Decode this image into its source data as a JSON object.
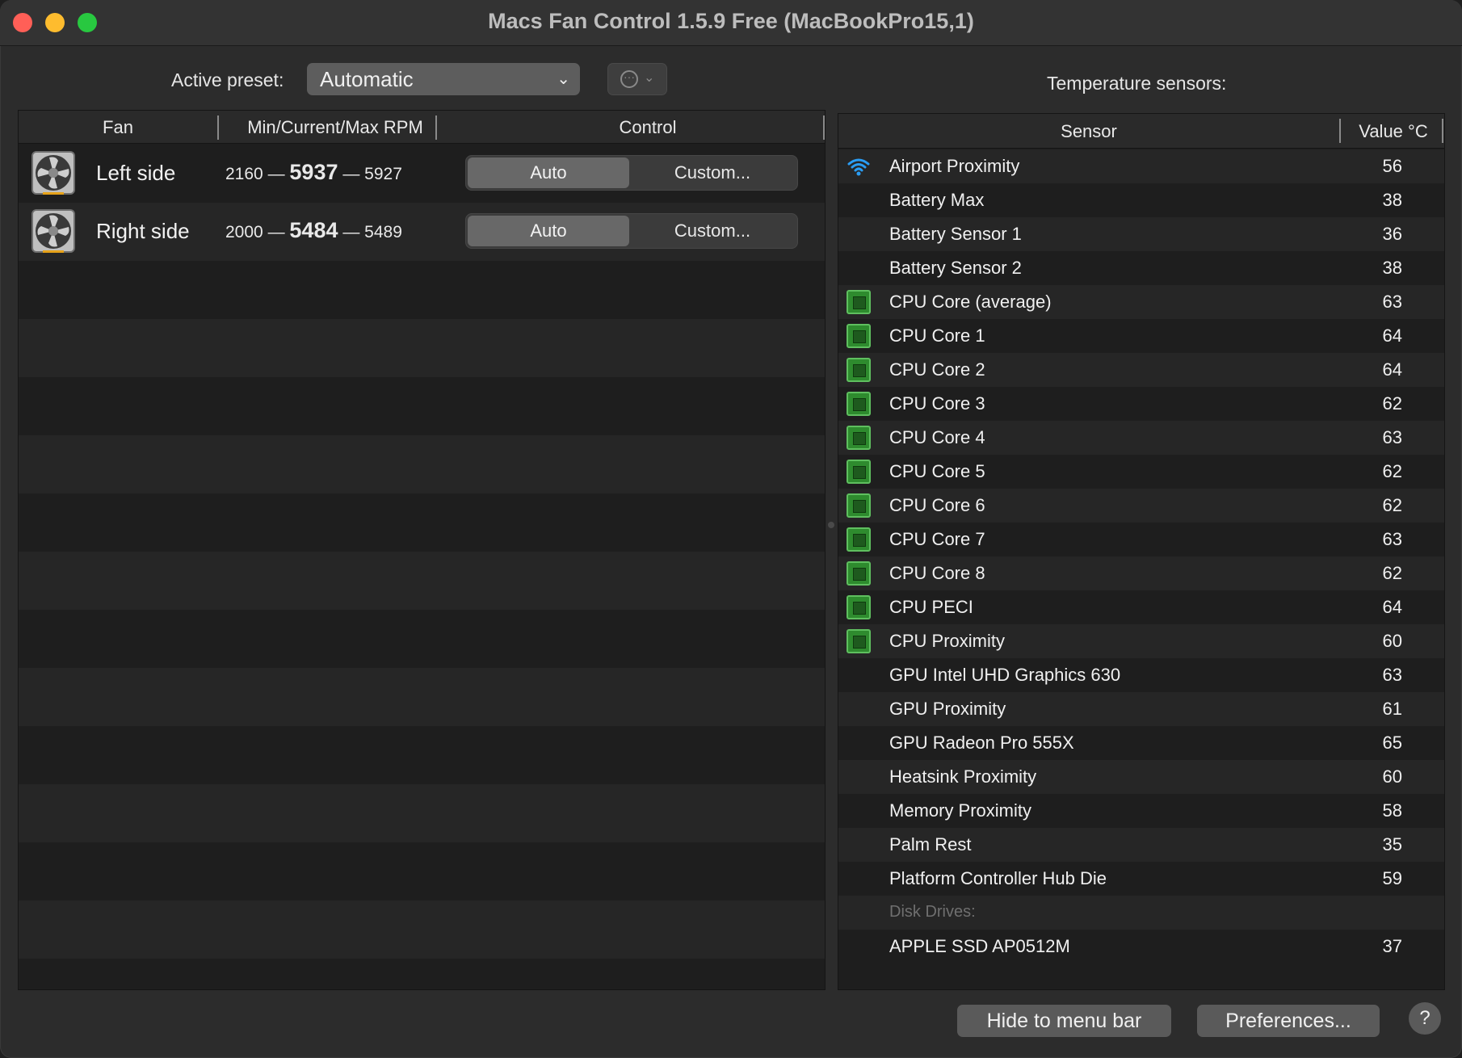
{
  "window": {
    "title": "Macs Fan Control 1.5.9 Free (MacBookPro15,1)"
  },
  "toolbar": {
    "preset_label": "Active preset:",
    "preset_value": "Automatic",
    "sensors_label": "Temperature sensors:"
  },
  "fans": {
    "columns": {
      "fan": "Fan",
      "rpm": "Min/Current/Max RPM",
      "control": "Control"
    },
    "rows": [
      {
        "name": "Left side",
        "min": "2160",
        "current": "5937",
        "max": "5927",
        "auto_label": "Auto",
        "custom_label": "Custom..."
      },
      {
        "name": "Right side",
        "min": "2000",
        "current": "5484",
        "max": "5489",
        "auto_label": "Auto",
        "custom_label": "Custom..."
      }
    ],
    "separator": "—"
  },
  "sensors": {
    "columns": {
      "sensor": "Sensor",
      "value": "Value °C"
    },
    "rows": [
      {
        "icon": "wifi-icon",
        "name": "Airport Proximity",
        "value": "56"
      },
      {
        "icon": "",
        "name": "Battery Max",
        "value": "38"
      },
      {
        "icon": "",
        "name": "Battery Sensor 1",
        "value": "36"
      },
      {
        "icon": "",
        "name": "Battery Sensor 2",
        "value": "38"
      },
      {
        "icon": "cpu-chip-icon",
        "name": "CPU Core (average)",
        "value": "63"
      },
      {
        "icon": "cpu-chip-icon",
        "name": "CPU Core 1",
        "value": "64"
      },
      {
        "icon": "cpu-chip-icon",
        "name": "CPU Core 2",
        "value": "64"
      },
      {
        "icon": "cpu-chip-icon",
        "name": "CPU Core 3",
        "value": "62"
      },
      {
        "icon": "cpu-chip-icon",
        "name": "CPU Core 4",
        "value": "63"
      },
      {
        "icon": "cpu-chip-icon",
        "name": "CPU Core 5",
        "value": "62"
      },
      {
        "icon": "cpu-chip-icon",
        "name": "CPU Core 6",
        "value": "62"
      },
      {
        "icon": "cpu-chip-icon",
        "name": "CPU Core 7",
        "value": "63"
      },
      {
        "icon": "cpu-chip-icon",
        "name": "CPU Core 8",
        "value": "62"
      },
      {
        "icon": "cpu-chip-icon",
        "name": "CPU PECI",
        "value": "64"
      },
      {
        "icon": "cpu-chip-icon",
        "name": "CPU Proximity",
        "value": "60"
      },
      {
        "icon": "gpu-card-icon",
        "name": "GPU Intel UHD Graphics 630",
        "value": "63"
      },
      {
        "icon": "gpu-card-icon",
        "name": "GPU Proximity",
        "value": "61"
      },
      {
        "icon": "gpu-card-icon",
        "name": "GPU Radeon Pro 555X",
        "value": "65"
      },
      {
        "icon": "",
        "name": "Heatsink Proximity",
        "value": "60"
      },
      {
        "icon": "",
        "name": "Memory Proximity",
        "value": "58"
      },
      {
        "icon": "",
        "name": "Palm Rest",
        "value": "35"
      },
      {
        "icon": "",
        "name": "Platform Controller Hub Die",
        "value": "59"
      },
      {
        "group": true,
        "name": "Disk Drives:",
        "value": ""
      },
      {
        "icon": "ssd-icon",
        "name": "APPLE SSD AP0512M",
        "value": "37"
      }
    ]
  },
  "footer": {
    "hide_label": "Hide to menu bar",
    "prefs_label": "Preferences...",
    "help_label": "?"
  }
}
